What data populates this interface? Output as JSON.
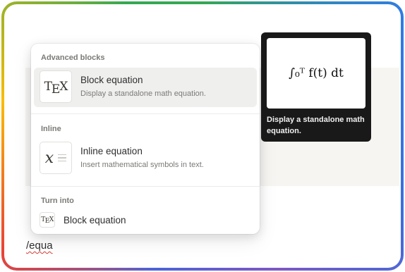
{
  "editor": {
    "slash_query": "/equa"
  },
  "menu": {
    "sections": [
      {
        "title": "Advanced blocks",
        "items": [
          {
            "title": "Block equation",
            "description": "Display a standalone math equation.",
            "icon": "tex-icon",
            "active": true
          }
        ]
      },
      {
        "title": "Inline",
        "items": [
          {
            "title": "Inline equation",
            "description": "Insert mathematical symbols in text.",
            "icon": "inline-math-icon",
            "active": false
          }
        ]
      },
      {
        "title": "Turn into",
        "items": [
          {
            "title": "Block equation",
            "icon": "tex-icon"
          }
        ]
      }
    ]
  },
  "preview": {
    "formula": "∫₀ᵀ f(t) dt",
    "description": "Display a standalone math equation."
  },
  "icons": {
    "tex": {
      "t": "T",
      "e": "E",
      "x": "X"
    },
    "inline_math": "x"
  },
  "colors": {
    "active_item_bg": "#efefee",
    "tooltip_bg": "#191919",
    "spellcheck_underline": "#d83a2e"
  }
}
